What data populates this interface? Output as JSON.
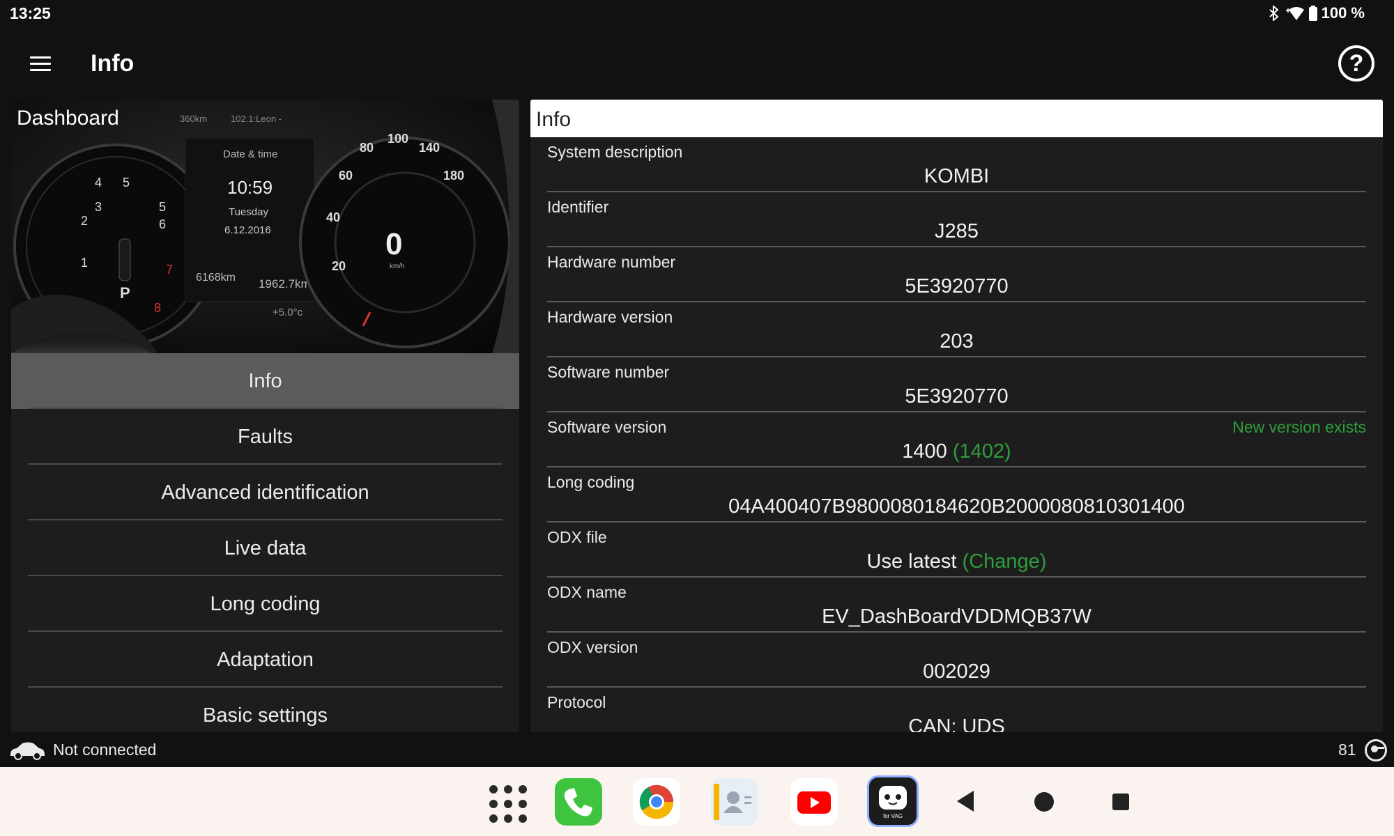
{
  "status_bar": {
    "time": "13:25",
    "battery": "100 %"
  },
  "app_bar": {
    "title": "Info"
  },
  "left_panel": {
    "image_label": "Dashboard",
    "image_texts": {
      "date_time_label": "Date & time",
      "clock": "10:59",
      "day": "Tuesday",
      "date": "6.12.2016",
      "odometer": "6168km",
      "trip": "1962.7km",
      "temperature": "+5.0°c",
      "radio": "102.1:Leon -",
      "range": "360km",
      "speed": "0",
      "speed_unit": "km/h"
    },
    "menu_items": [
      {
        "label": "Info",
        "active": true
      },
      {
        "label": "Faults",
        "active": false
      },
      {
        "label": "Advanced identification",
        "active": false
      },
      {
        "label": "Live data",
        "active": false
      },
      {
        "label": "Long coding",
        "active": false
      },
      {
        "label": "Adaptation",
        "active": false
      },
      {
        "label": "Basic settings",
        "active": false
      }
    ]
  },
  "right_panel": {
    "header": "Info",
    "rows": [
      {
        "label": "System description",
        "value": "KOMBI"
      },
      {
        "label": "Identifier",
        "value": "J285"
      },
      {
        "label": "Hardware number",
        "value": "5E3920770"
      },
      {
        "label": "Hardware version",
        "value": "203"
      },
      {
        "label": "Software number",
        "value": "5E3920770"
      },
      {
        "label": "Software version",
        "value": "1400",
        "value_extra": "(1402)",
        "note": "New version exists"
      },
      {
        "label": "Long coding",
        "value": "04A400407B9800080184620B2000080810301400"
      },
      {
        "label": "ODX file",
        "value": "Use latest",
        "value_extra": "(Change)"
      },
      {
        "label": "ODX name",
        "value": "EV_DashBoardVDDMQB37W"
      },
      {
        "label": "ODX version",
        "value": "002029"
      },
      {
        "label": "Protocol",
        "value": "CAN: UDS"
      }
    ]
  },
  "footer": {
    "connection_status": "Not connected",
    "count": "81"
  },
  "dock": {
    "vag_label": "for VAG"
  },
  "colors": {
    "accent_green": "#2e9e3c",
    "active_item": "#5b5b5b",
    "panel": "#1d1d1d"
  }
}
